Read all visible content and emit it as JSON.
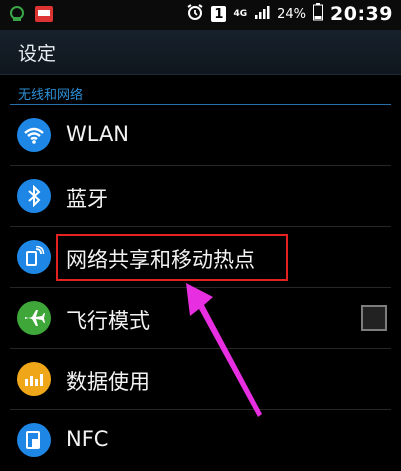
{
  "statusbar": {
    "battery": "24%",
    "time": "20:39",
    "badge": "1",
    "network": "4G"
  },
  "appbar": {
    "title": "设定"
  },
  "section": {
    "header": "无线和网络"
  },
  "rows": [
    {
      "label": "WLAN",
      "icon": "wifi-icon",
      "color": "#1e87e5"
    },
    {
      "label": "蓝牙",
      "icon": "bluetooth-icon",
      "color": "#1e87e5"
    },
    {
      "label": "网络共享和移动热点",
      "icon": "tethering-icon",
      "color": "#1e87e5"
    },
    {
      "label": "飞行模式",
      "icon": "airplane-icon",
      "color": "#3fa63a"
    },
    {
      "label": "数据使用",
      "icon": "data-usage-icon",
      "color": "#f0a619"
    },
    {
      "label": "NFC",
      "icon": "nfc-icon",
      "color": "#1e87e5"
    }
  ],
  "airplane_mode": {
    "checked": false
  }
}
